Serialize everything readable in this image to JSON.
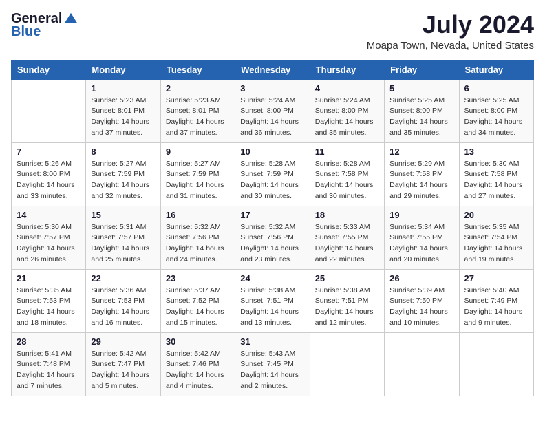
{
  "header": {
    "logo_general": "General",
    "logo_blue": "Blue",
    "title": "July 2024",
    "subtitle": "Moapa Town, Nevada, United States"
  },
  "columns": [
    "Sunday",
    "Monday",
    "Tuesday",
    "Wednesday",
    "Thursday",
    "Friday",
    "Saturday"
  ],
  "weeks": [
    [
      {
        "day": "",
        "sunrise": "",
        "sunset": "",
        "daylight": ""
      },
      {
        "day": "1",
        "sunrise": "Sunrise: 5:23 AM",
        "sunset": "Sunset: 8:01 PM",
        "daylight": "Daylight: 14 hours and 37 minutes."
      },
      {
        "day": "2",
        "sunrise": "Sunrise: 5:23 AM",
        "sunset": "Sunset: 8:01 PM",
        "daylight": "Daylight: 14 hours and 37 minutes."
      },
      {
        "day": "3",
        "sunrise": "Sunrise: 5:24 AM",
        "sunset": "Sunset: 8:00 PM",
        "daylight": "Daylight: 14 hours and 36 minutes."
      },
      {
        "day": "4",
        "sunrise": "Sunrise: 5:24 AM",
        "sunset": "Sunset: 8:00 PM",
        "daylight": "Daylight: 14 hours and 35 minutes."
      },
      {
        "day": "5",
        "sunrise": "Sunrise: 5:25 AM",
        "sunset": "Sunset: 8:00 PM",
        "daylight": "Daylight: 14 hours and 35 minutes."
      },
      {
        "day": "6",
        "sunrise": "Sunrise: 5:25 AM",
        "sunset": "Sunset: 8:00 PM",
        "daylight": "Daylight: 14 hours and 34 minutes."
      }
    ],
    [
      {
        "day": "7",
        "sunrise": "Sunrise: 5:26 AM",
        "sunset": "Sunset: 8:00 PM",
        "daylight": "Daylight: 14 hours and 33 minutes."
      },
      {
        "day": "8",
        "sunrise": "Sunrise: 5:27 AM",
        "sunset": "Sunset: 7:59 PM",
        "daylight": "Daylight: 14 hours and 32 minutes."
      },
      {
        "day": "9",
        "sunrise": "Sunrise: 5:27 AM",
        "sunset": "Sunset: 7:59 PM",
        "daylight": "Daylight: 14 hours and 31 minutes."
      },
      {
        "day": "10",
        "sunrise": "Sunrise: 5:28 AM",
        "sunset": "Sunset: 7:59 PM",
        "daylight": "Daylight: 14 hours and 30 minutes."
      },
      {
        "day": "11",
        "sunrise": "Sunrise: 5:28 AM",
        "sunset": "Sunset: 7:58 PM",
        "daylight": "Daylight: 14 hours and 30 minutes."
      },
      {
        "day": "12",
        "sunrise": "Sunrise: 5:29 AM",
        "sunset": "Sunset: 7:58 PM",
        "daylight": "Daylight: 14 hours and 29 minutes."
      },
      {
        "day": "13",
        "sunrise": "Sunrise: 5:30 AM",
        "sunset": "Sunset: 7:58 PM",
        "daylight": "Daylight: 14 hours and 27 minutes."
      }
    ],
    [
      {
        "day": "14",
        "sunrise": "Sunrise: 5:30 AM",
        "sunset": "Sunset: 7:57 PM",
        "daylight": "Daylight: 14 hours and 26 minutes."
      },
      {
        "day": "15",
        "sunrise": "Sunrise: 5:31 AM",
        "sunset": "Sunset: 7:57 PM",
        "daylight": "Daylight: 14 hours and 25 minutes."
      },
      {
        "day": "16",
        "sunrise": "Sunrise: 5:32 AM",
        "sunset": "Sunset: 7:56 PM",
        "daylight": "Daylight: 14 hours and 24 minutes."
      },
      {
        "day": "17",
        "sunrise": "Sunrise: 5:32 AM",
        "sunset": "Sunset: 7:56 PM",
        "daylight": "Daylight: 14 hours and 23 minutes."
      },
      {
        "day": "18",
        "sunrise": "Sunrise: 5:33 AM",
        "sunset": "Sunset: 7:55 PM",
        "daylight": "Daylight: 14 hours and 22 minutes."
      },
      {
        "day": "19",
        "sunrise": "Sunrise: 5:34 AM",
        "sunset": "Sunset: 7:55 PM",
        "daylight": "Daylight: 14 hours and 20 minutes."
      },
      {
        "day": "20",
        "sunrise": "Sunrise: 5:35 AM",
        "sunset": "Sunset: 7:54 PM",
        "daylight": "Daylight: 14 hours and 19 minutes."
      }
    ],
    [
      {
        "day": "21",
        "sunrise": "Sunrise: 5:35 AM",
        "sunset": "Sunset: 7:53 PM",
        "daylight": "Daylight: 14 hours and 18 minutes."
      },
      {
        "day": "22",
        "sunrise": "Sunrise: 5:36 AM",
        "sunset": "Sunset: 7:53 PM",
        "daylight": "Daylight: 14 hours and 16 minutes."
      },
      {
        "day": "23",
        "sunrise": "Sunrise: 5:37 AM",
        "sunset": "Sunset: 7:52 PM",
        "daylight": "Daylight: 14 hours and 15 minutes."
      },
      {
        "day": "24",
        "sunrise": "Sunrise: 5:38 AM",
        "sunset": "Sunset: 7:51 PM",
        "daylight": "Daylight: 14 hours and 13 minutes."
      },
      {
        "day": "25",
        "sunrise": "Sunrise: 5:38 AM",
        "sunset": "Sunset: 7:51 PM",
        "daylight": "Daylight: 14 hours and 12 minutes."
      },
      {
        "day": "26",
        "sunrise": "Sunrise: 5:39 AM",
        "sunset": "Sunset: 7:50 PM",
        "daylight": "Daylight: 14 hours and 10 minutes."
      },
      {
        "day": "27",
        "sunrise": "Sunrise: 5:40 AM",
        "sunset": "Sunset: 7:49 PM",
        "daylight": "Daylight: 14 hours and 9 minutes."
      }
    ],
    [
      {
        "day": "28",
        "sunrise": "Sunrise: 5:41 AM",
        "sunset": "Sunset: 7:48 PM",
        "daylight": "Daylight: 14 hours and 7 minutes."
      },
      {
        "day": "29",
        "sunrise": "Sunrise: 5:42 AM",
        "sunset": "Sunset: 7:47 PM",
        "daylight": "Daylight: 14 hours and 5 minutes."
      },
      {
        "day": "30",
        "sunrise": "Sunrise: 5:42 AM",
        "sunset": "Sunset: 7:46 PM",
        "daylight": "Daylight: 14 hours and 4 minutes."
      },
      {
        "day": "31",
        "sunrise": "Sunrise: 5:43 AM",
        "sunset": "Sunset: 7:45 PM",
        "daylight": "Daylight: 14 hours and 2 minutes."
      },
      {
        "day": "",
        "sunrise": "",
        "sunset": "",
        "daylight": ""
      },
      {
        "day": "",
        "sunrise": "",
        "sunset": "",
        "daylight": ""
      },
      {
        "day": "",
        "sunrise": "",
        "sunset": "",
        "daylight": ""
      }
    ]
  ]
}
